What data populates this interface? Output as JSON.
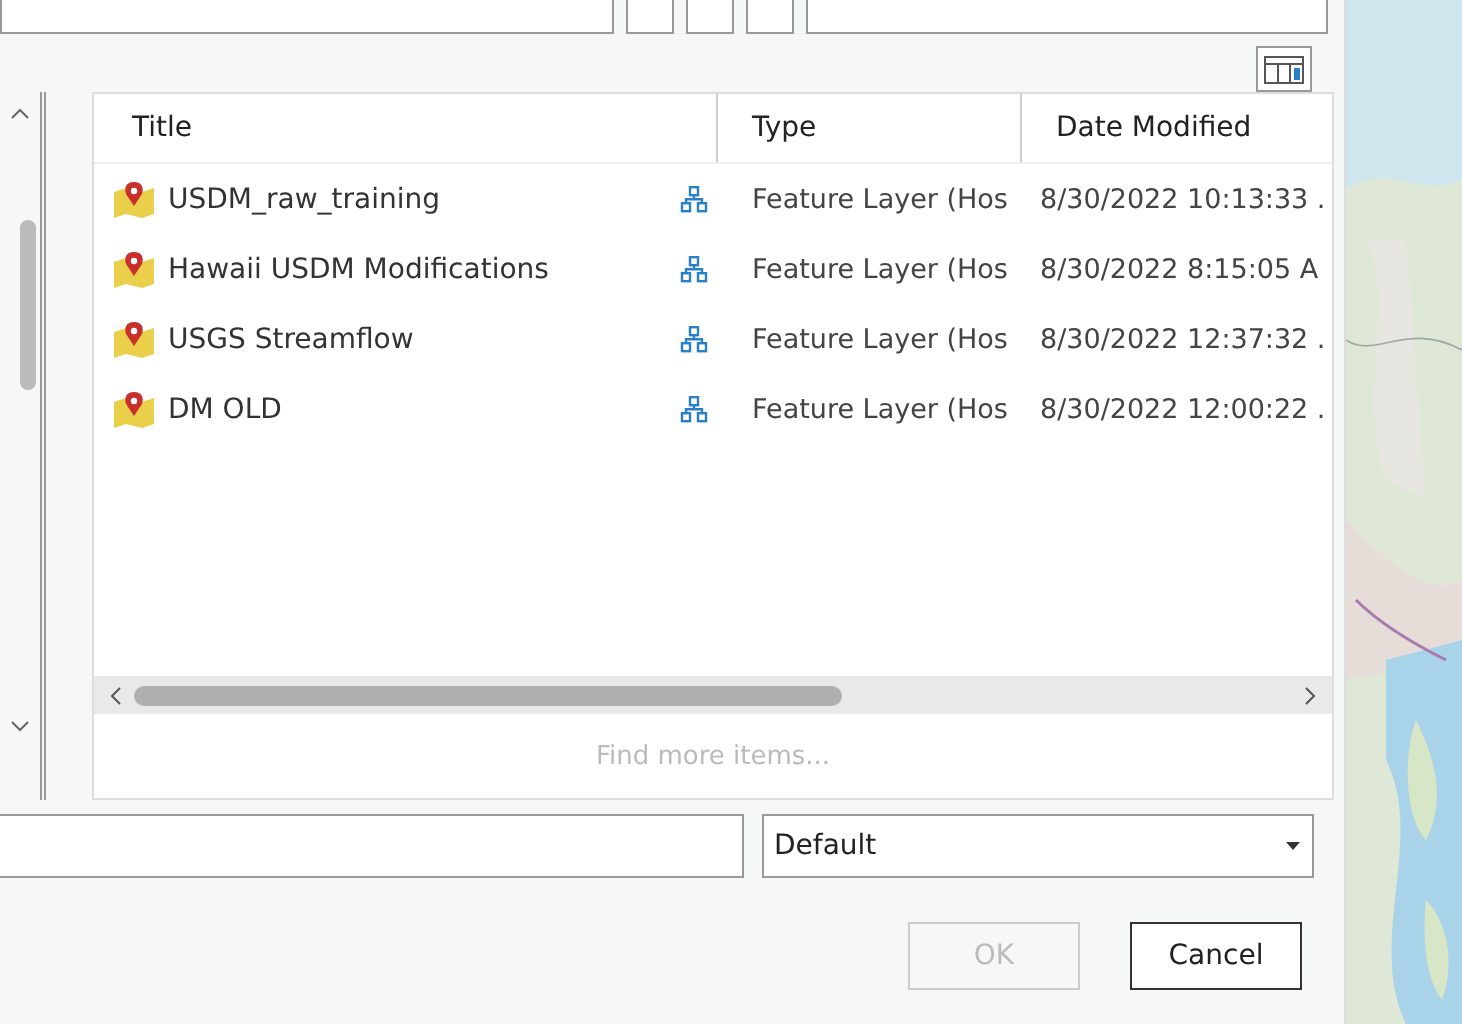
{
  "table": {
    "columns": [
      {
        "label": "Title"
      },
      {
        "label": "Type"
      },
      {
        "label": "Date Modified"
      }
    ],
    "rows": [
      {
        "title": "USDM_raw_training",
        "type": "Feature Layer (Hos",
        "date": "8/30/2022 10:13:33 ."
      },
      {
        "title": "Hawaii USDM Modifications",
        "type": "Feature Layer (Hos",
        "date": "8/30/2022 8:15:05 A"
      },
      {
        "title": "USGS Streamflow",
        "type": "Feature Layer (Hos",
        "date": "8/30/2022 12:37:32 ."
      },
      {
        "title": "DM OLD",
        "type": "Feature Layer (Hos",
        "date": "8/30/2022 12:00:22 ."
      }
    ]
  },
  "find_more": "Find more items...",
  "filter_dropdown": {
    "value": "Default"
  },
  "buttons": [
    {
      "label": "OK",
      "disabled": true
    },
    {
      "label": "Cancel",
      "disabled": false
    }
  ]
}
